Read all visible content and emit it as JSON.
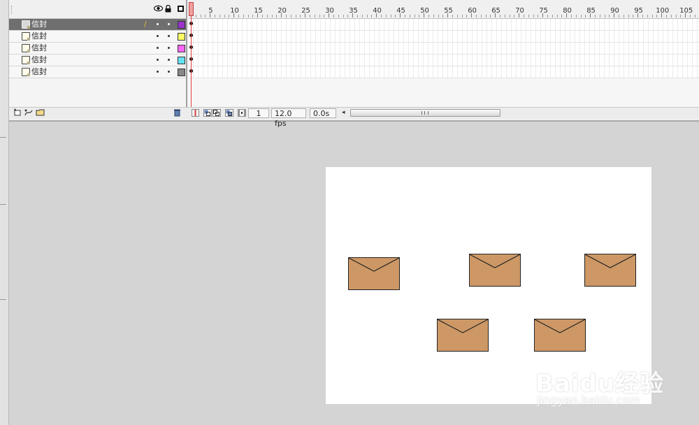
{
  "timeline": {
    "ruler_labels": [
      "5",
      "10",
      "15",
      "20",
      "25",
      "30",
      "35",
      "40",
      "45",
      "50",
      "55",
      "60",
      "65",
      "70",
      "75",
      "80",
      "85",
      "90",
      "95",
      "100",
      "105"
    ],
    "layers": [
      {
        "name": "信封",
        "color": "#9933cc",
        "selected": true
      },
      {
        "name": "信封",
        "color": "#ffff66",
        "selected": false
      },
      {
        "name": "信封",
        "color": "#ff66ff",
        "selected": false
      },
      {
        "name": "信封",
        "color": "#66e0f0",
        "selected": false
      },
      {
        "name": "信封",
        "color": "#888888",
        "selected": false
      }
    ],
    "toolbar": {
      "current_frame": "1",
      "frame_rate": "12.0 fps",
      "elapsed_time": "0.0s"
    }
  },
  "stage": {
    "envelope_fill": "#cd9866",
    "envelope_count": 5
  },
  "watermark": {
    "brand": "Baidu经验",
    "url": "jingyan.baidu.com"
  },
  "icons": {
    "eye": "eye-icon",
    "lock": "lock-icon",
    "outline": "outline-icon",
    "trash": "trash-icon"
  }
}
